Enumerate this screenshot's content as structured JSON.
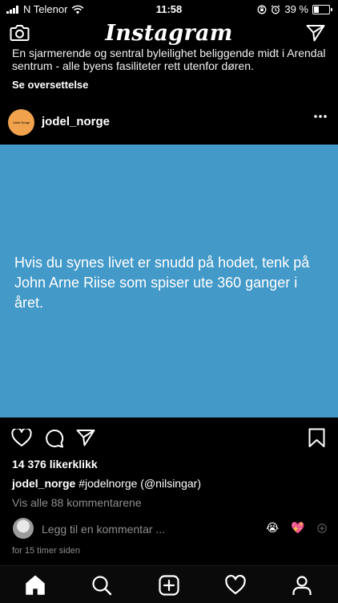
{
  "status_bar": {
    "carrier": "N Telenor",
    "time": "11:58",
    "battery_percent": "39 %",
    "battery_level": 0.39
  },
  "app": {
    "logo": "Instagram",
    "camera_icon": "camera-icon",
    "direct_icon": "paper-plane-icon"
  },
  "previous_post": {
    "caption_tail": "En sjarmerende og sentral byleilighet beliggende midt i Arendal sentrum - alle byens fasiliteter rett utenfor døren.",
    "see_translation": "Se oversettelse"
  },
  "post": {
    "username": "jodel_norge",
    "avatar_text": "Jodel Norge",
    "more_icon": "more-dots-icon",
    "image_text": "Hvis du synes livet er snudd på hodet, tenk på John Arne Riise som spiser ute 360 ganger i året.",
    "image_bg": "#4399c8",
    "likes": "14 376 likerklikk",
    "caption_user": "jodel_norge",
    "caption_text": " #jodelnorge (@nilsingar)",
    "view_comments": "Vis alle 88 kommentarene",
    "add_comment_placeholder": "Legg til en kommentar ...",
    "quick_emojis": [
      "😭",
      "💖"
    ],
    "time_ago": "for 15 timer siden"
  },
  "bottom_nav": [
    "home-icon",
    "search-icon",
    "add-post-icon",
    "heart-icon",
    "profile-icon"
  ]
}
